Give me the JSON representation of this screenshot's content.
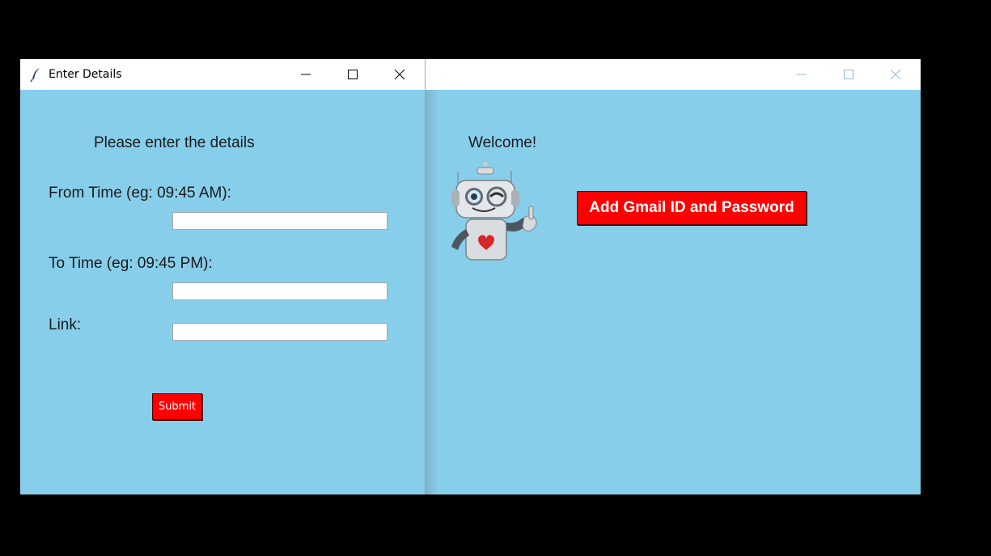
{
  "main_window": {
    "title": "Enter Details",
    "heading": "Please enter the details",
    "from_time_label": "From Time (eg: 09:45 AM):",
    "to_time_label": "To Time (eg: 09:45 PM):",
    "link_label": "Link:",
    "from_time_value": "",
    "to_time_value": "",
    "link_value": "",
    "submit_label": "Submit"
  },
  "back_window": {
    "title": "",
    "welcome_text": "Welcome!",
    "gmail_button_label": "Add Gmail ID and Password"
  },
  "colors": {
    "window_background": "#87CEEB",
    "button_red": "#FF0000",
    "button_text": "#FFFFFF",
    "desktop": "#000000"
  },
  "icons": {
    "title_icon": "feather-icon",
    "minimize": "minimize-icon",
    "maximize": "maximize-icon",
    "close": "close-icon",
    "mascot": "robot-illustration"
  }
}
